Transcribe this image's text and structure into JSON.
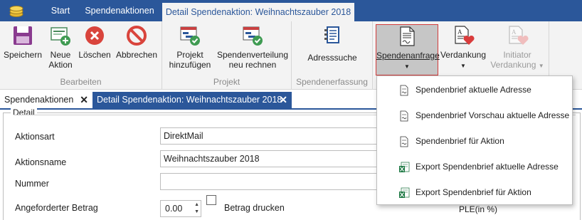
{
  "tabs": {
    "start": "Start",
    "spendenaktionen": "Spendenaktionen",
    "detail": "Detail Spendenaktion: Weihnachtszauber 2018"
  },
  "ribbon": {
    "bearbeiten": {
      "label": "Bearbeiten",
      "speichern": "Speichern",
      "neue_aktion_1": "Neue",
      "neue_aktion_2": "Aktion",
      "loeschen": "Löschen",
      "abbrechen": "Abbrechen"
    },
    "projekt": {
      "label": "Projekt",
      "hinzu_1": "Projekt",
      "hinzu_2": "hinzufügen",
      "verteilung_1": "Spendenverteilung",
      "verteilung_2": "neu rechnen"
    },
    "spendenerfassung": {
      "label": "Spendenerfassung",
      "adresssuche": "Adresssuche"
    },
    "other": {
      "spendenanfrage": "Spendenanfrage",
      "verdankung": "Verdankung",
      "initiator_1": "Initiator",
      "initiator_2": "Verdankung"
    }
  },
  "doc_tabs": {
    "spendenaktionen": "Spendenaktionen",
    "detail": "Detail Spendenaktion: Weihnachtszauber 2018"
  },
  "detail": {
    "legend": "Detail",
    "aktionsart_label": "Aktionsart",
    "aktionsart_value": "DirektMail",
    "aktionsname_label": "Aktionsname",
    "aktionsname_value": "Weihnachtszauber 2018",
    "nummer_label": "Nummer",
    "nummer_value": "",
    "betrag_label": "Angeforderter Betrag",
    "betrag_value": "0.00",
    "betrag_drucken": "Betrag drucken",
    "ple": "PLE(in %)"
  },
  "menu": {
    "items": [
      "Spendenbrief aktuelle Adresse",
      "Spendenbrief Vorschau aktuelle Adresse",
      "Spendenbrief für Aktion",
      "Export Spendenbrief aktuelle Adresse",
      "Export Spendenbrief für Aktion"
    ]
  },
  "colors": {
    "accent": "#2b579a",
    "selected_border": "#d23c3c"
  }
}
